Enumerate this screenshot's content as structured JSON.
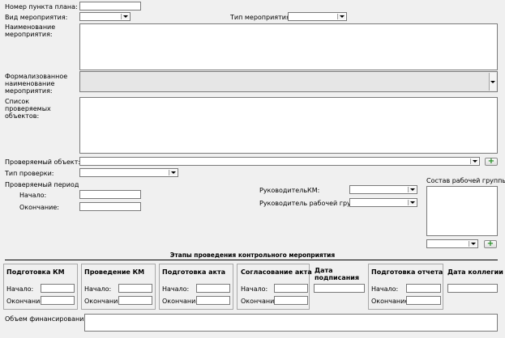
{
  "form": {
    "plan_number_label": "Номер пункта плана:",
    "event_kind_label": "Вид мероприятия:",
    "event_type_label": "Тип мероприятия:",
    "event_name_label": "Наименование мероприятия:",
    "formal_name_label": "Формализованное наименование мероприятия:",
    "objects_list_label": "Список проверяемых объектов:",
    "checked_object_label": "Проверяемый объект:",
    "check_type_label": "Тип проверки:",
    "period_label": "Проверяемый период",
    "period_start_label": "Начало:",
    "period_end_label": "Окончание:",
    "head_km_label": "РуководительКМ:",
    "head_group_label": "Руководитель рабочей группы:",
    "working_group_label": "Состав рабочей группы:",
    "financing_label": "Объем финансирования:",
    "add_button_label": "+"
  },
  "stages": {
    "title": "Этапы проведения контрольного мероприятия",
    "start_label": "Начало:",
    "end_label": "Окончание:",
    "km_prep": "Подготовка КМ",
    "km_conduct": "Проведение КМ",
    "act_prep": "Подготовка акта",
    "act_approval": "Согласование акта",
    "sign_date": "Дата подписания",
    "report_prep": "Подготовка отчета",
    "board_date": "Дата коллегии"
  },
  "icons": {
    "dropdown": "chevron-down-icon",
    "add": "plus-icon"
  },
  "colors": {
    "background": "#f0f0f0",
    "field_bg": "#ffffff",
    "disabled_field_bg": "#e6e6e6",
    "border": "#7a7a7a",
    "plus_green": "#1a8a1a"
  }
}
